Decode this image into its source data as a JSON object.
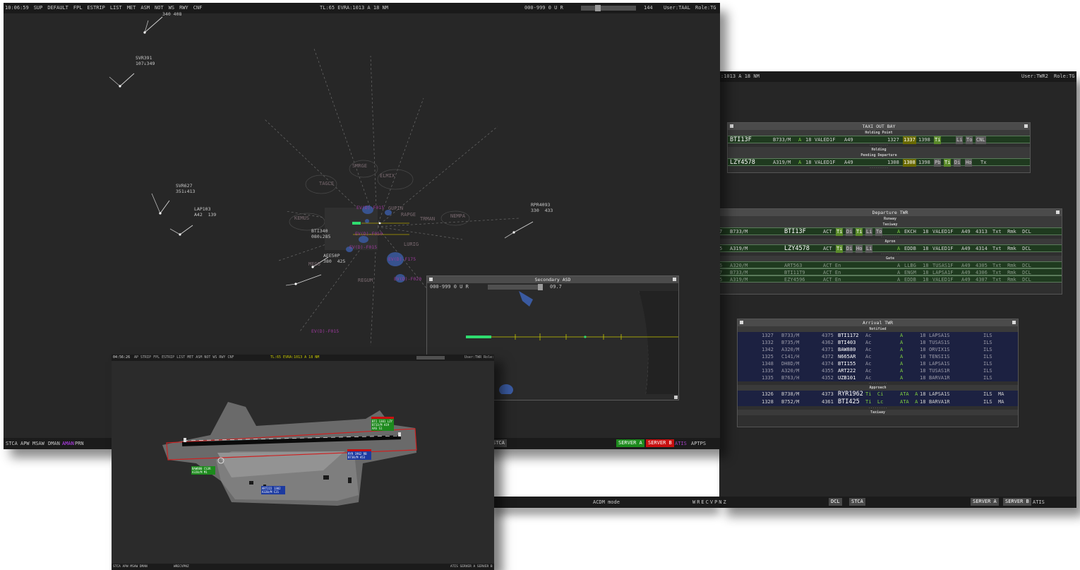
{
  "main_window": {
    "time": "10:06:59",
    "menu": [
      "SUP",
      "DEFAULT",
      "FPL",
      "ESTRIP",
      "LIST",
      "MET",
      "ASM",
      "NOT",
      "WS",
      "RWY",
      "CNF"
    ],
    "center_info": "TL:65  EVRA:1013  A  18  NM",
    "alt_filter": "000-999  0  U  R",
    "range_value": "144",
    "user": "User:TAAL",
    "role": "Role:TG",
    "bottom_left": [
      "STCA",
      "APW",
      "MSAW",
      "DMAN"
    ],
    "bottom_left_highlight": "AMAN",
    "bottom_left_last": "PRN",
    "stca_btn": "STCA",
    "server_a": "SERVER A",
    "server_b": "SERVER B",
    "atis": "ATIS",
    "aptps": "APTPS",
    "tracks": [
      {
        "l1": "SVR391",
        "l2": "107↓349"
      },
      {
        "l1": "SVR627",
        "l2": "351↓413"
      },
      {
        "l1": "LAP103",
        "l2": "A42  139"
      },
      {
        "l1": "BTI340",
        "l2": "080↓285"
      },
      {
        "l1": "AEE50P",
        "l2": "380  425"
      },
      {
        "l1": "RPR4093",
        "l2": "330  433"
      },
      {
        "l1": "",
        "l2": "340 408"
      }
    ],
    "fixes": [
      "SMRGE",
      "ELMIX",
      "TAGLE",
      "GUPIN",
      "KEMUS",
      "RAPGE",
      "TRMAN",
      "NEMPA",
      "LURIG",
      "REGUM",
      "MEGO"
    ],
    "areas": [
      "EV(D)-F015",
      "EV(D)-F050",
      "EV(D)-F015",
      "EV(D)-F175",
      "EV(D)-F020",
      "EV(D)-F015"
    ]
  },
  "secondary_asd": {
    "title": "Secondary ASD",
    "alt_filter": "000-999  0  U  R",
    "range_value": "09.7"
  },
  "airport_window": {
    "time": "04:56:26",
    "menu": "AP  STRIP  FPL  ESTRIP  LIST  MET  ASM  NOT  WS  RWY  CNF",
    "status": "TL:65  EVRA:1013  A  18  NM",
    "user": "User:TWR  Role:TG",
    "bottom_left": "STCA  APW  MSAW  DMAN",
    "bottom_mid": "WRECVPNZ",
    "bottom_right": "ATIS  SERVER A  SERVER B",
    "labels": [
      {
        "l1": "BTI  1301  LZY",
        "l2": "B733/M  A19",
        "l3": "AAS  S1"
      },
      {
        "l1": "RYR  1962  RB",
        "l2": "B738/M  A53"
      },
      {
        "l1": "BAW880  CS3R",
        "l2": "A320/M  M1"
      },
      {
        "l1": "ART222  1302",
        "l2": "A320/M  C21"
      }
    ]
  },
  "tower_window": {
    "topbar_left": ":1013  A  18  NM",
    "user": "User:TWR2",
    "role": "Role:TG",
    "bottom_mode": "ACDM mode",
    "bottom_codes": "WRECVPNZ",
    "btn_dcl": "DCL",
    "btn_stca": "STCA",
    "btn_server_a": "SERVER A",
    "btn_server_b": "SERVER B",
    "atis": "ATIS"
  },
  "taxi_out_bay": {
    "title": "TAXI OUT BAY",
    "sections": [
      "Holding Point",
      "Holding",
      "Pending Departure"
    ],
    "rows": [
      {
        "callsign": "BTI13F",
        "type": "B733/M",
        "a": "A",
        "rwy": "18",
        "sid": "VALED1F",
        "ss": "A49",
        "t1": "1327",
        "t2": "1337",
        "t3": "1398",
        "chips": [
          "Ti",
          "Li",
          "To",
          "CNL"
        ]
      },
      {
        "callsign": "LZY4578",
        "type": "A319/M",
        "a": "A",
        "rwy": "18",
        "sid": "VALED1F",
        "ss": "A49",
        "t1": "1308",
        "t2": "1308",
        "t3": "1398",
        "chips": [
          "Pb",
          "Ti",
          "Di",
          "Ho",
          "Tx"
        ]
      }
    ]
  },
  "departure_twr": {
    "title": "Departure TWR",
    "sections": [
      "Runway",
      "Taxiway",
      "Apron",
      "Gate"
    ],
    "rows": [
      {
        "n": "7",
        "type": "B733/M",
        "callsign": "BTI13F",
        "status": "ACT",
        "chips": [
          "Ti",
          "Di",
          "Ti",
          "Li",
          "To"
        ],
        "a": "A",
        "dest": "EKCH",
        "rwy": "18",
        "sid": "VALED1F",
        "ss": "A49",
        "code": "4313",
        "tail": "Txt  Rmk  DCL"
      },
      {
        "n": "5",
        "type": "A319/M",
        "callsign": "LZY4578",
        "status": "ACT",
        "chips": [
          "Ti",
          "Di",
          "Ho",
          "Li"
        ],
        "a": "A",
        "dest": "EDDB",
        "rwy": "18",
        "sid": "VALED1F",
        "ss": "A49",
        "code": "4314",
        "tail": "Txt  Rmk  DCL"
      },
      {
        "n": "6",
        "type": "A320/M",
        "callsign": "ART563",
        "status": "ACT En",
        "a": "A",
        "dest": "LLBG",
        "rwy": "18",
        "sid": "TUSAS1F",
        "ss": "A49",
        "code": "4305",
        "tail": "Txt  Rmk  DCL"
      },
      {
        "n": "7",
        "type": "B733/M",
        "callsign": "BTI11T9",
        "status": "ACT En",
        "a": "A",
        "dest": "ENGM",
        "rwy": "18",
        "sid": "LAPSA1F",
        "ss": "A49",
        "code": "4306",
        "tail": "Txt  Rmk  DCL"
      },
      {
        "n": "5",
        "type": "A319/M",
        "callsign": "EZY4596",
        "status": "ACT En",
        "a": "A",
        "dest": "EDDB",
        "rwy": "18",
        "sid": "VALED1F",
        "ss": "A49",
        "code": "4307",
        "tail": "Txt  Rmk  DCL"
      }
    ]
  },
  "arrival_twr": {
    "title": "Arrival TWR",
    "sections": [
      "Notified",
      "Approach",
      "Taxiway"
    ],
    "notified": [
      {
        "t": "1327",
        "type": "B733/M",
        "code": "4375",
        "callsign": "BTI1172",
        "st": "Ac",
        "a": "A",
        "rwy": "18",
        "star": "LAPSA1S",
        "app": "ILS"
      },
      {
        "t": "1332",
        "type": "B735/M",
        "code": "4362",
        "callsign": "BTI403",
        "st": "Ac",
        "a": "A",
        "rwy": "18",
        "star": "TUSAS1S",
        "app": "ILS"
      },
      {
        "t": "1342",
        "type": "A320/M",
        "code": "4371",
        "callsign": "BAW880",
        "st": "Ac",
        "a": "A",
        "rwy": "18",
        "star": "ORVIX1S",
        "app": "ILS"
      },
      {
        "t": "1325",
        "type": "C141/H",
        "code": "4372",
        "callsign": "N665AR",
        "st": "Ac",
        "a": "A",
        "rwy": "18",
        "star": "TENSI1S",
        "app": "ILS"
      },
      {
        "t": "1348",
        "type": "DH8D/M",
        "code": "4374",
        "callsign": "BTI155",
        "st": "Ac",
        "a": "A",
        "rwy": "18",
        "star": "LAPSA1S",
        "app": "ILS"
      },
      {
        "t": "1335",
        "type": "A320/M",
        "code": "4355",
        "callsign": "ART222",
        "st": "Ac",
        "a": "A",
        "rwy": "18",
        "star": "TUSAS1R",
        "app": "ILS"
      },
      {
        "t": "1335",
        "type": "B763/H",
        "code": "4352",
        "callsign": "UZB101",
        "st": "Ac",
        "a": "A",
        "rwy": "18",
        "star": "BARVA1R",
        "app": "ILS"
      }
    ],
    "approach": [
      {
        "t": "1326",
        "type": "B738/M",
        "code": "4373",
        "callsign": "RYR1962",
        "st": "Ti  Ci",
        "a": "ATA  A",
        "rwy": "18",
        "star": "LAPSA1S",
        "app": "ILS  MA"
      },
      {
        "t": "1328",
        "type": "B752/M",
        "code": "4361",
        "callsign": "BTI425",
        "st": "Ti  Lc",
        "a": "ATA  A",
        "rwy": "18",
        "star": "BARVA1R",
        "app": "ILS  MA"
      }
    ]
  },
  "colors": {
    "server_a": "#1d8a1d",
    "server_b": "#c81010",
    "accent_yellow": "#c8c800",
    "atis_magenta": "#a040c0"
  }
}
